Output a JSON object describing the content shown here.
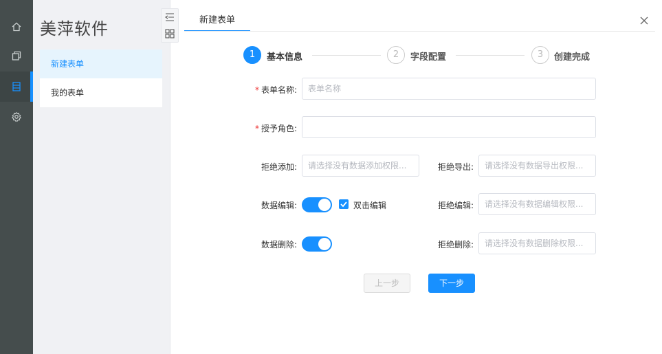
{
  "rail": {
    "items": [
      {
        "icon": "home-icon"
      },
      {
        "icon": "copy-icon"
      },
      {
        "icon": "form-icon"
      },
      {
        "icon": "gear-icon"
      }
    ],
    "active_index": 2
  },
  "sidebar": {
    "brand": "美萍软件",
    "items": [
      {
        "label": "新建表单",
        "active": true
      },
      {
        "label": "我的表单",
        "active": false
      }
    ]
  },
  "tabs": [
    {
      "label": "新建表单",
      "active": true
    }
  ],
  "steps": [
    {
      "number": "1",
      "label": "基本信息",
      "status": "active"
    },
    {
      "number": "2",
      "label": "字段配置",
      "status": "pending"
    },
    {
      "number": "3",
      "label": "创建完成",
      "status": "pending"
    }
  ],
  "form": {
    "form_name": {
      "label": "表单名称:",
      "required": true,
      "placeholder": "表单名称",
      "value": ""
    },
    "grant_role": {
      "label": "授予角色:",
      "required": true,
      "placeholder": "",
      "value": ""
    },
    "deny_add": {
      "label": "拒绝添加:",
      "placeholder": "请选择没有数据添加权限..."
    },
    "deny_export": {
      "label": "拒绝导出:",
      "placeholder": "请选择没有数据导出权限..."
    },
    "data_edit": {
      "label": "数据编辑:",
      "enabled": true
    },
    "dblclick_edit": {
      "label": "双击编辑",
      "checked": true
    },
    "deny_edit": {
      "label": "拒绝编辑:",
      "placeholder": "请选择没有数据编辑权限..."
    },
    "data_delete": {
      "label": "数据删除:",
      "enabled": true
    },
    "deny_delete": {
      "label": "拒绝删除:",
      "placeholder": "请选择没有数据删除权限..."
    }
  },
  "buttons": {
    "prev": "上一步",
    "next": "下一步"
  },
  "colors": {
    "accent": "#1890ff",
    "rail_bg": "#454d4d",
    "sidebar_bg": "#f0f1f4"
  }
}
